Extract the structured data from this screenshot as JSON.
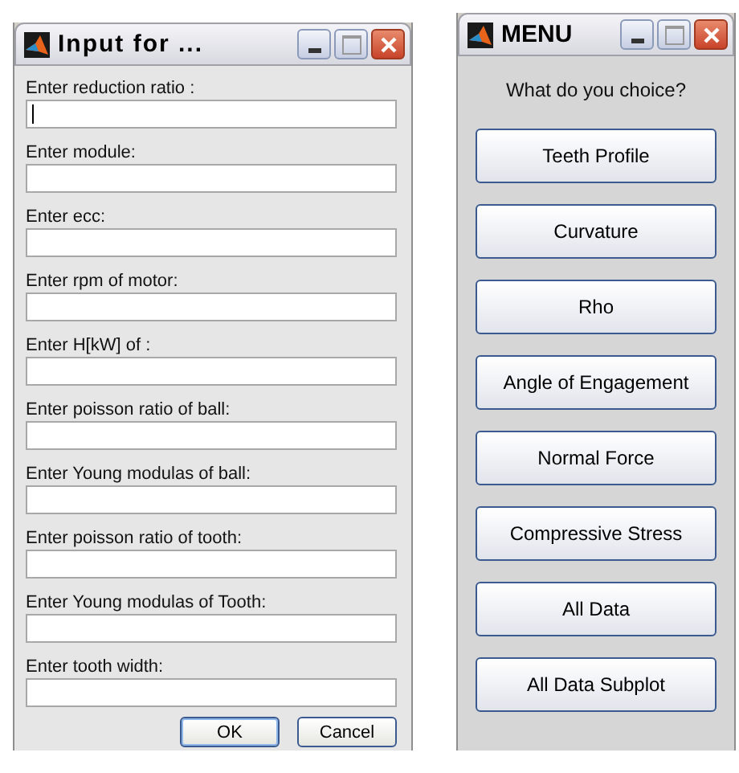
{
  "input_dialog": {
    "title": "Input for ...",
    "fields": [
      {
        "label": "Enter reduction ratio :",
        "focused": true
      },
      {
        "label": "Enter module:",
        "focused": false
      },
      {
        "label": "Enter ecc:",
        "focused": false
      },
      {
        "label": "Enter rpm of motor:",
        "focused": false
      },
      {
        "label": "Enter H[kW] of :",
        "focused": false
      },
      {
        "label": "Enter poisson ratio of ball:",
        "focused": false
      },
      {
        "label": "Enter Young modulas of ball:",
        "focused": false
      },
      {
        "label": "Enter poisson ratio of tooth:",
        "focused": false
      },
      {
        "label": "Enter Young modulas of Tooth:",
        "focused": false
      },
      {
        "label": "Enter tooth width:",
        "focused": false
      }
    ],
    "buttons": [
      "OK",
      "Cancel"
    ]
  },
  "menu_window": {
    "title": "MENU",
    "prompt": "What do you choice?",
    "buttons": [
      "Teeth Profile",
      "Curvature",
      "Rho",
      "Angle of Engagement",
      "Normal Force",
      "Compressive Stress",
      "All Data",
      "All Data Subplot"
    ]
  }
}
